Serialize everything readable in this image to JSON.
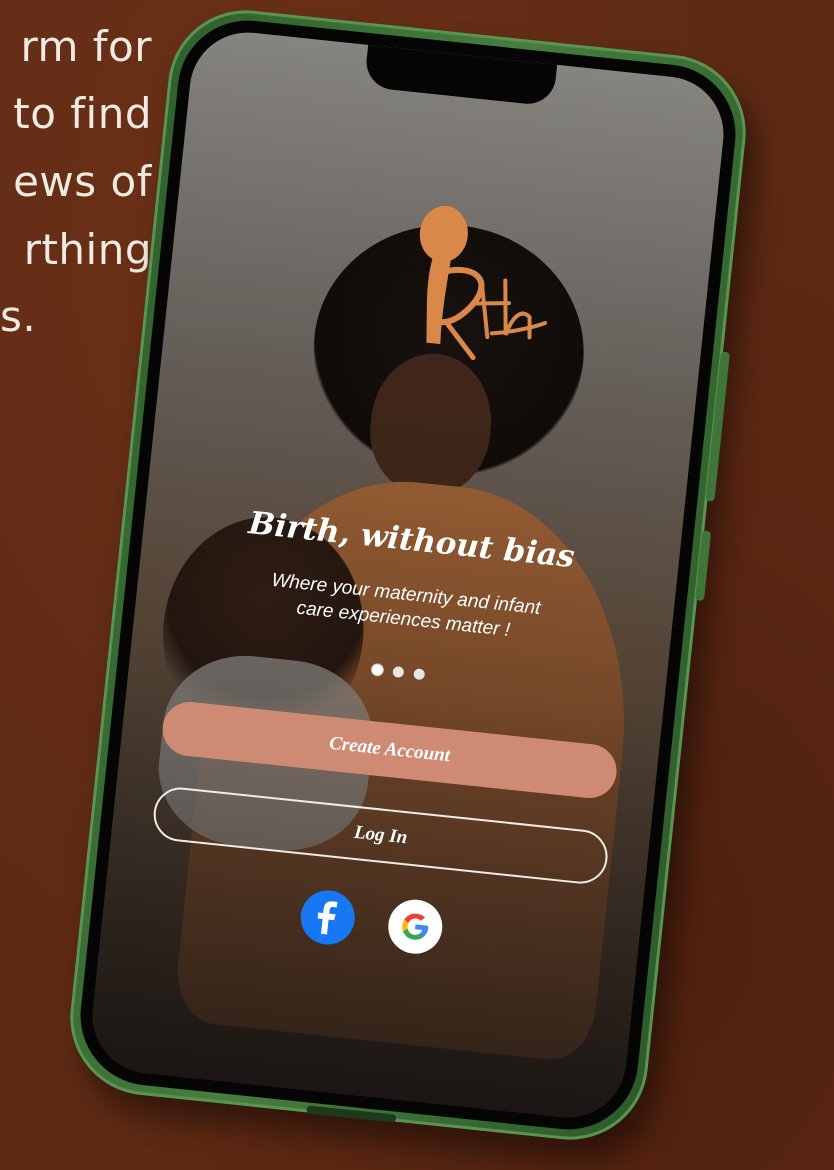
{
  "side_copy": {
    "lines": [
      "rm for",
      "to find",
      "ews of",
      "rthing",
      "s."
    ]
  },
  "app": {
    "logo_text": "Rth",
    "headline": "Birth, without bias",
    "tagline_line1": "Where your maternity and infant",
    "tagline_line2": "care experiences matter !",
    "carousel": {
      "total": 3,
      "active_index": 0
    },
    "create_account_label": "Create Account",
    "login_label": "Log In",
    "social": [
      {
        "name": "facebook",
        "icon": "facebook-icon"
      },
      {
        "name": "google",
        "icon": "google-icon"
      }
    ]
  },
  "colors": {
    "background": "#5e2a14",
    "phone_frame": "#467e3d",
    "primary_button": "#cf8a74",
    "logo_accent": "#d9884a",
    "facebook_blue": "#1877f2"
  }
}
